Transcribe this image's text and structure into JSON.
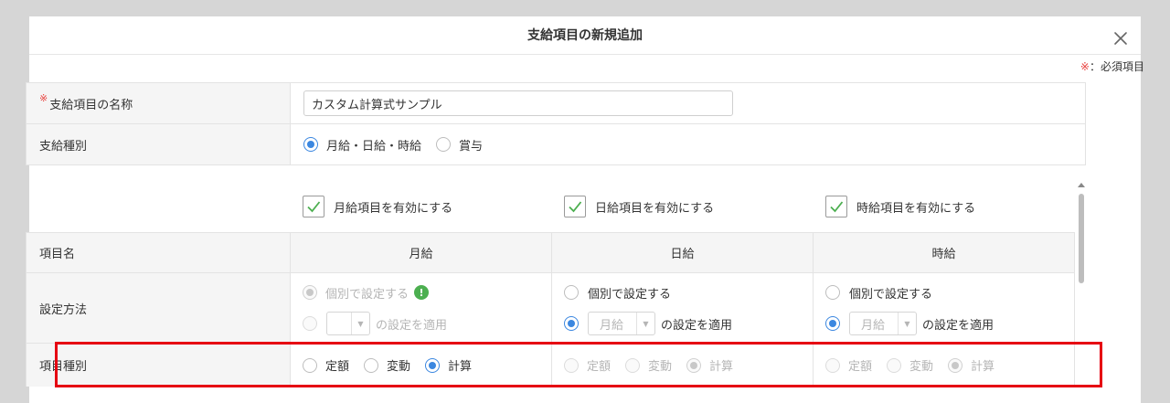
{
  "dialog": {
    "title": "支給項目の新規追加",
    "required_mark": "※",
    "required_note": "：必須項目"
  },
  "form": {
    "name": {
      "label": "支給項目の名称",
      "value": "カスタム計算式サンプル"
    },
    "kind": {
      "label": "支給種別",
      "options": [
        {
          "label": "月給・日給・時給",
          "selected": true
        },
        {
          "label": "賞与",
          "selected": false
        }
      ]
    }
  },
  "enable": {
    "monthly": "月給項目を有効にする",
    "daily": "日給項目を有効にする",
    "hourly": "時給項目を有効にする"
  },
  "grid": {
    "header_label": "項目名",
    "columns": [
      "月給",
      "日給",
      "時給"
    ],
    "method": {
      "label": "設定方法",
      "individual": "個別で設定する",
      "apply_suffix": "の設定を適用",
      "select_value": "月給"
    },
    "type": {
      "label": "項目種別",
      "options": [
        "定額",
        "変動",
        "計算"
      ]
    }
  },
  "colors": {
    "accent": "#3b87e0",
    "required": "#e8423f",
    "highlight": "#e60012",
    "check": "#4caf50"
  }
}
